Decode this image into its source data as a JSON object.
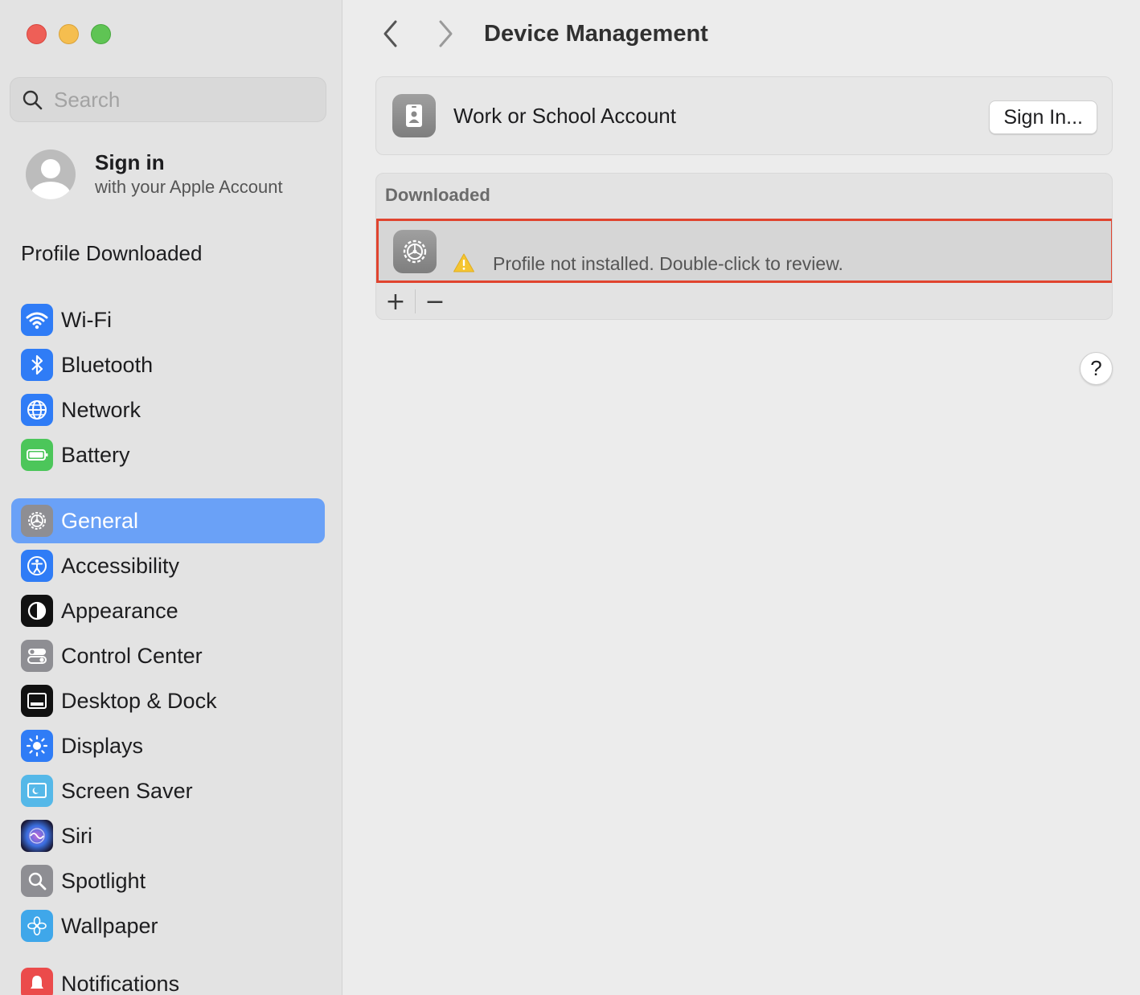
{
  "sidebar": {
    "search_placeholder": "Search",
    "account": {
      "title": "Sign in",
      "subtitle": "with your Apple Account"
    },
    "profile_downloaded": "Profile Downloaded",
    "group1": [
      {
        "label": "Wi-Fi",
        "icon": "wifi-icon",
        "color": "#2f7cf6"
      },
      {
        "label": "Bluetooth",
        "icon": "bluetooth-icon",
        "color": "#2f7cf6"
      },
      {
        "label": "Network",
        "icon": "globe-icon",
        "color": "#2f7cf6"
      },
      {
        "label": "Battery",
        "icon": "battery-icon",
        "color": "#4cc65a"
      }
    ],
    "group2": [
      {
        "label": "General",
        "icon": "gear-icon",
        "color": "#8e8e93",
        "active": true
      },
      {
        "label": "Accessibility",
        "icon": "accessibility-icon",
        "color": "#2f7cf6"
      },
      {
        "label": "Appearance",
        "icon": "appearance-icon",
        "color": "#111111"
      },
      {
        "label": "Control Center",
        "icon": "control-center-icon",
        "color": "#8e8e93"
      },
      {
        "label": "Desktop & Dock",
        "icon": "dock-icon",
        "color": "#111111"
      },
      {
        "label": "Displays",
        "icon": "sun-icon",
        "color": "#2f7cf6"
      },
      {
        "label": "Screen Saver",
        "icon": "screen-saver-icon",
        "color": "#55b8e8"
      },
      {
        "label": "Siri",
        "icon": "siri-icon",
        "color": "#222244"
      },
      {
        "label": "Spotlight",
        "icon": "magnifier-icon",
        "color": "#8e8e93"
      },
      {
        "label": "Wallpaper",
        "icon": "flower-icon",
        "color": "#3fa7ea"
      }
    ],
    "group3": [
      {
        "label": "Notifications",
        "icon": "bell-icon",
        "color": "#eb4b4b"
      }
    ]
  },
  "main": {
    "title": "Device Management",
    "work_account": {
      "label": "Work or School Account",
      "button": "Sign In..."
    },
    "downloaded": {
      "header": "Downloaded",
      "row_text": "Profile not installed. Double-click to review.",
      "add_label": "+",
      "remove_label": "−"
    },
    "help_label": "?"
  },
  "colors": {
    "accent": "#6aa1f7",
    "highlight_border": "#e0442f"
  }
}
